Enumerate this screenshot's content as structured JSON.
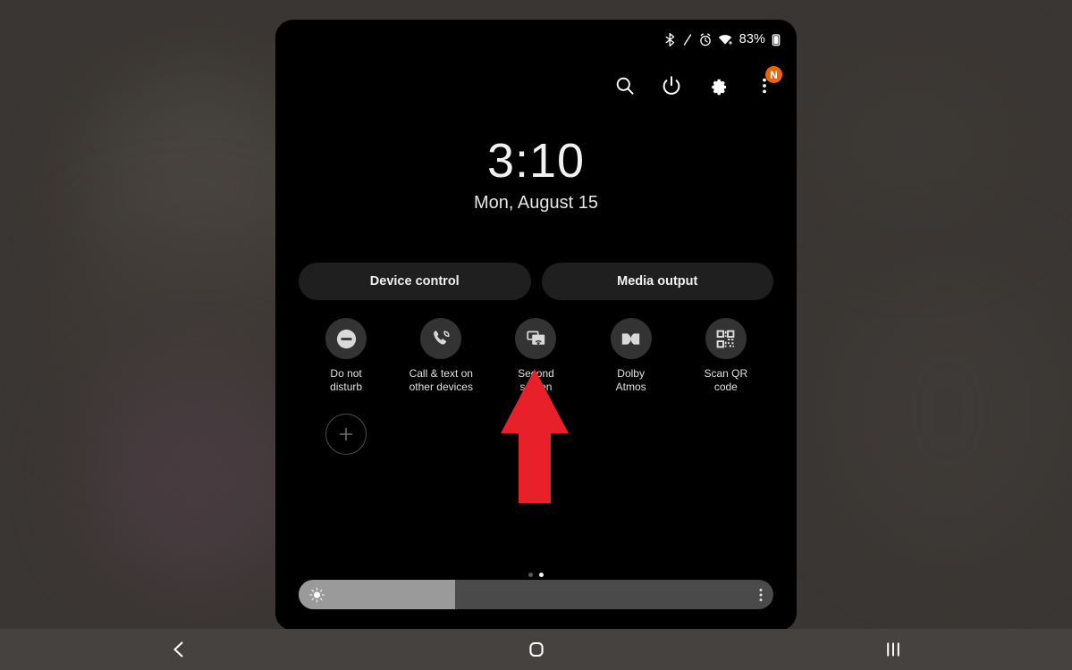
{
  "wallpaper": {
    "background_color": "#3a3633"
  },
  "panel": {
    "background_color": "#000000"
  },
  "status_bar": {
    "icons": [
      "bluetooth-icon",
      "pen-slash-icon",
      "alarm-icon",
      "wifi-icon"
    ],
    "battery_percent": "83%"
  },
  "top_actions": {
    "search_label": "search-icon",
    "power_label": "power-icon",
    "settings_label": "settings-gear-icon",
    "more_label": "more-options-icon",
    "badge_text": "N",
    "badge_color": "#ec6608"
  },
  "clock": {
    "time": "3:10",
    "date": "Mon, August 15"
  },
  "pills": [
    {
      "label": "Device control"
    },
    {
      "label": "Media output"
    }
  ],
  "tiles": [
    {
      "label": "Do not\ndisturb",
      "icon": "do-not-disturb-icon"
    },
    {
      "label": "Call & text on\nother devices",
      "icon": "call-text-other-devices-icon"
    },
    {
      "label": "Second\nscreen",
      "icon": "second-screen-icon"
    },
    {
      "label": "Dolby\nAtmos",
      "icon": "dolby-atmos-icon"
    },
    {
      "label": "Scan QR\ncode",
      "icon": "scan-qr-code-icon"
    }
  ],
  "add_tile": {
    "icon": "plus-icon"
  },
  "page_dots": {
    "count": 2,
    "active_index": 1
  },
  "brightness": {
    "value_percent": 33,
    "sun_icon": "brightness-sun-icon",
    "menu_icon": "more-options-icon"
  },
  "annotation": {
    "arrow_color": "#e8202a",
    "points_at": "Second screen"
  },
  "nav_bar": {
    "back_label": "back-icon",
    "home_label": "home-icon",
    "recents_label": "recents-icon",
    "background_color": "#46423f"
  }
}
